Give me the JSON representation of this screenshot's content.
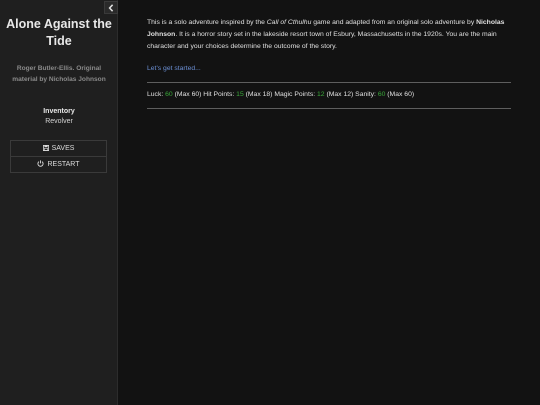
{
  "sidebar": {
    "title": "Alone Against the Tide",
    "author": "Roger Butler-Ellis. Original material by Nicholas Johnson",
    "inventory_title": "Inventory",
    "inventory_items": [
      "Revolver"
    ],
    "saves_label": "SAVES",
    "restart_label": "RESTART",
    "toggle_icon": "chevron-left-icon"
  },
  "main": {
    "intro": {
      "t1": "This is a solo adventure inspired by the ",
      "game": "Call of Cthulhu",
      "t2": " game and adapted from an original solo adventure by ",
      "author": "Nicholas Johnson",
      "t3": ". It is a horror story set in the lakeside resort town of Esbury, Massachusetts in the 1920s. You are the main character and your choices determine the outcome of the story."
    },
    "start_link": "Let's get started...",
    "stats": {
      "luck_label": "Luck: ",
      "luck_value": "60",
      "luck_max": " (Max 60) ",
      "hp_label": "Hit Points: ",
      "hp_value": "15",
      "hp_max": " (Max 18) ",
      "mp_label": "Magic Points: ",
      "mp_value": "12",
      "mp_max": " (Max 12) ",
      "sanity_label": "Sanity: ",
      "sanity_value": "60",
      "sanity_max": " (Max 60)"
    }
  },
  "colors": {
    "background": "#121212",
    "sidebar": "#1f1f1f",
    "link": "#6b8fd4",
    "stat_value": "#3aa83a"
  }
}
